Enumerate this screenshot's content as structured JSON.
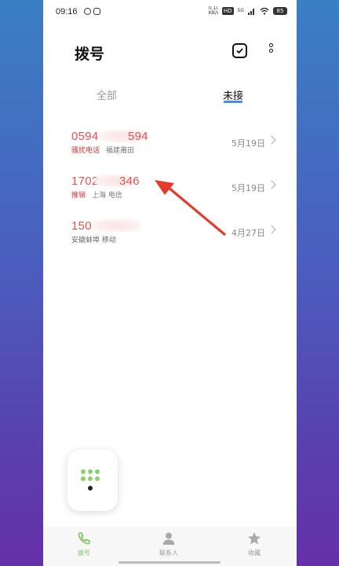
{
  "status_bar": {
    "time": "09:16",
    "net_speed": "0.10 KB/s",
    "hd_badge": "HD",
    "signal_badge": "5G",
    "battery": "85"
  },
  "header": {
    "title": "拨号"
  },
  "tabs": [
    {
      "label": "全部",
      "active": false
    },
    {
      "label": "未接",
      "active": true
    }
  ],
  "calls": [
    {
      "number_start": "0594",
      "number_end": "594",
      "tag": "骚扰电话",
      "location": "福建莆田",
      "date": "5月19日"
    },
    {
      "number_start": "1702",
      "number_end": "346",
      "tag": "推销",
      "location": "上海 电信",
      "date": "5月19日"
    },
    {
      "number_start": "150",
      "number_end": "",
      "tag": "",
      "location": "安徽蚌埠 移动",
      "date": "4月27日"
    }
  ],
  "bottom_nav": [
    {
      "label": "拨号",
      "icon": "phone-icon",
      "active": true
    },
    {
      "label": "联系人",
      "icon": "contact-icon",
      "active": false
    },
    {
      "label": "收藏",
      "icon": "star-icon",
      "active": false
    }
  ],
  "colors": {
    "missed_call": "#e05252",
    "accent": "#4a8fdc",
    "dialpad_dot": "#8fcf6a",
    "annotation_arrow": "#e8392c"
  }
}
